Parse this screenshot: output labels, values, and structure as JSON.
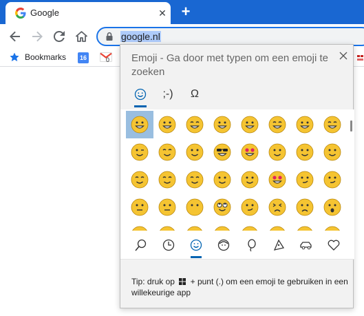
{
  "browser": {
    "tab_title": "Google",
    "tab_close": "✕",
    "new_tab": "+",
    "url": "google.nl",
    "colors": {
      "tabstrip": "#1967d2",
      "selection": "#aecbfa"
    }
  },
  "bookmarks": {
    "bookmarks_label": "Bookmarks",
    "calendar_badge": "16",
    "gmail_badge": "0"
  },
  "emoji_panel": {
    "title": "Emoji - Ga door met typen om een emoji te zoeken",
    "tabs": [
      {
        "label": "☺",
        "icon": "smiley-icon"
      },
      {
        "label": ";-)",
        "icon": "kaomoji"
      },
      {
        "label": "Ω",
        "icon": "symbols-icon"
      }
    ],
    "categories": [
      "search-icon",
      "recent-icon",
      "smiley-icon",
      "people-icon",
      "balloon-icon",
      "pizza-icon",
      "car-icon",
      "heart-icon"
    ],
    "emojis": [
      "grinning",
      "grinning-big",
      "joy",
      "rofl",
      "smiley",
      "grin",
      "sweat-smile",
      "laughing",
      "wink",
      "blush",
      "yum",
      "sunglasses",
      "heart-eyes",
      "kissing-heart",
      "kissing-hearts",
      "hugging-hand",
      "innocent",
      "smiling",
      "relaxed",
      "slight-smile",
      "hugging",
      "star-struck",
      "thinking",
      "raised-eyebrow",
      "neutral",
      "expressionless",
      "no-mouth",
      "eye-roll",
      "smirk",
      "persevere",
      "disappointed-relieved",
      "open-mouth"
    ],
    "tip_before": "Tip: druk op",
    "tip_after": "+ punt (.) om een emoji te gebruiken in een willekeurige app",
    "colors": {
      "accent": "#0063b1",
      "selected": "#99bee0",
      "face": "#f5c432"
    }
  }
}
